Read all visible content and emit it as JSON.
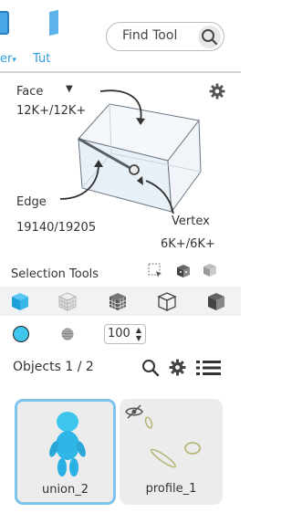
{
  "toolbar": {
    "tab1_label": "er",
    "tab2_label": "Tut"
  },
  "search": {
    "label": "Find Tool",
    "icon": "search-icon"
  },
  "cube": {
    "face_label": "Face",
    "face_count": "12K+/12K+",
    "edge_label": "Edge",
    "edge_count": "19140/19205",
    "vertex_label": "Vertex",
    "vertex_count": "6K+/6K+"
  },
  "selection": {
    "title": "Selection Tools",
    "number_value": "100"
  },
  "objects": {
    "header": "Objects 1 / 2",
    "items": [
      {
        "label": "union_2",
        "selected": true
      },
      {
        "label": "profile_1",
        "selected": false,
        "hidden": true
      }
    ]
  },
  "colors": {
    "accent": "#2f9fe0",
    "selected_border": "#7cc4ec",
    "object_cyan": "#3fc6ee"
  }
}
